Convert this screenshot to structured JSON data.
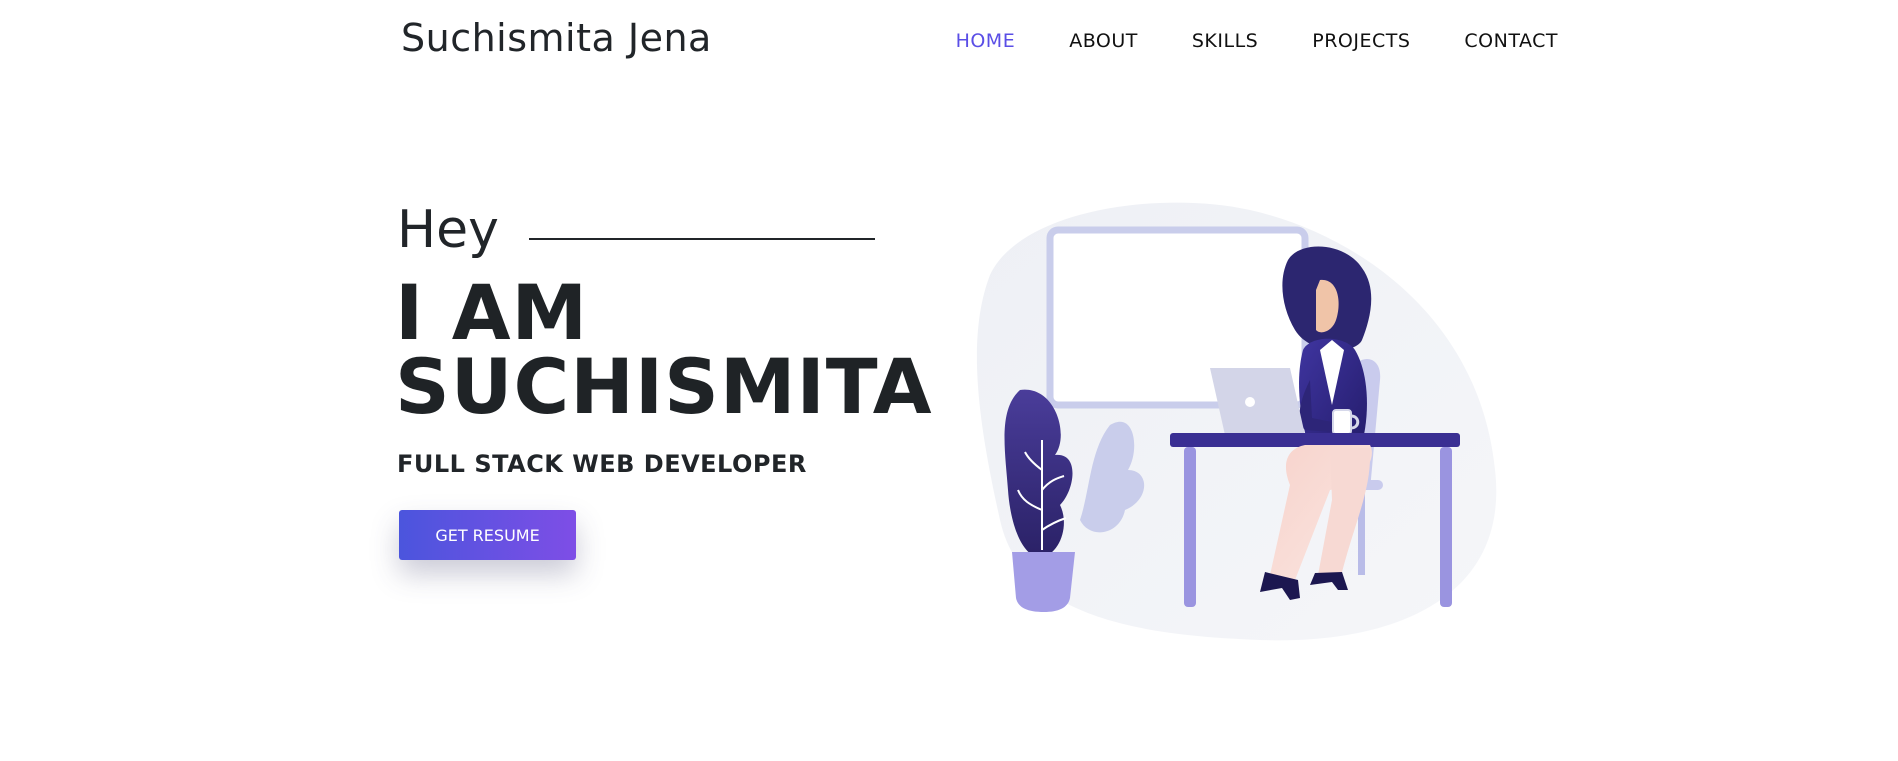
{
  "header": {
    "brand": "Suchismita Jena",
    "nav": [
      {
        "label": "HOME",
        "active": true
      },
      {
        "label": "ABOUT",
        "active": false
      },
      {
        "label": "SKILLS",
        "active": false
      },
      {
        "label": "PROJECTS",
        "active": false
      },
      {
        "label": "CONTACT",
        "active": false
      }
    ]
  },
  "hero": {
    "greeting": "Hey",
    "headline_line1": "I AM",
    "headline_line2": "SUCHISMITA",
    "role": "FULL STACK WEB DEVELOPER",
    "button_label": "GET RESUME"
  },
  "colors": {
    "accent": "#5a4ee6",
    "button_gradient_start": "#4b55dd",
    "button_gradient_end": "#7e4ee6",
    "text": "#212529"
  },
  "illustration": {
    "icon": "woman-working-at-desk-illustration"
  }
}
